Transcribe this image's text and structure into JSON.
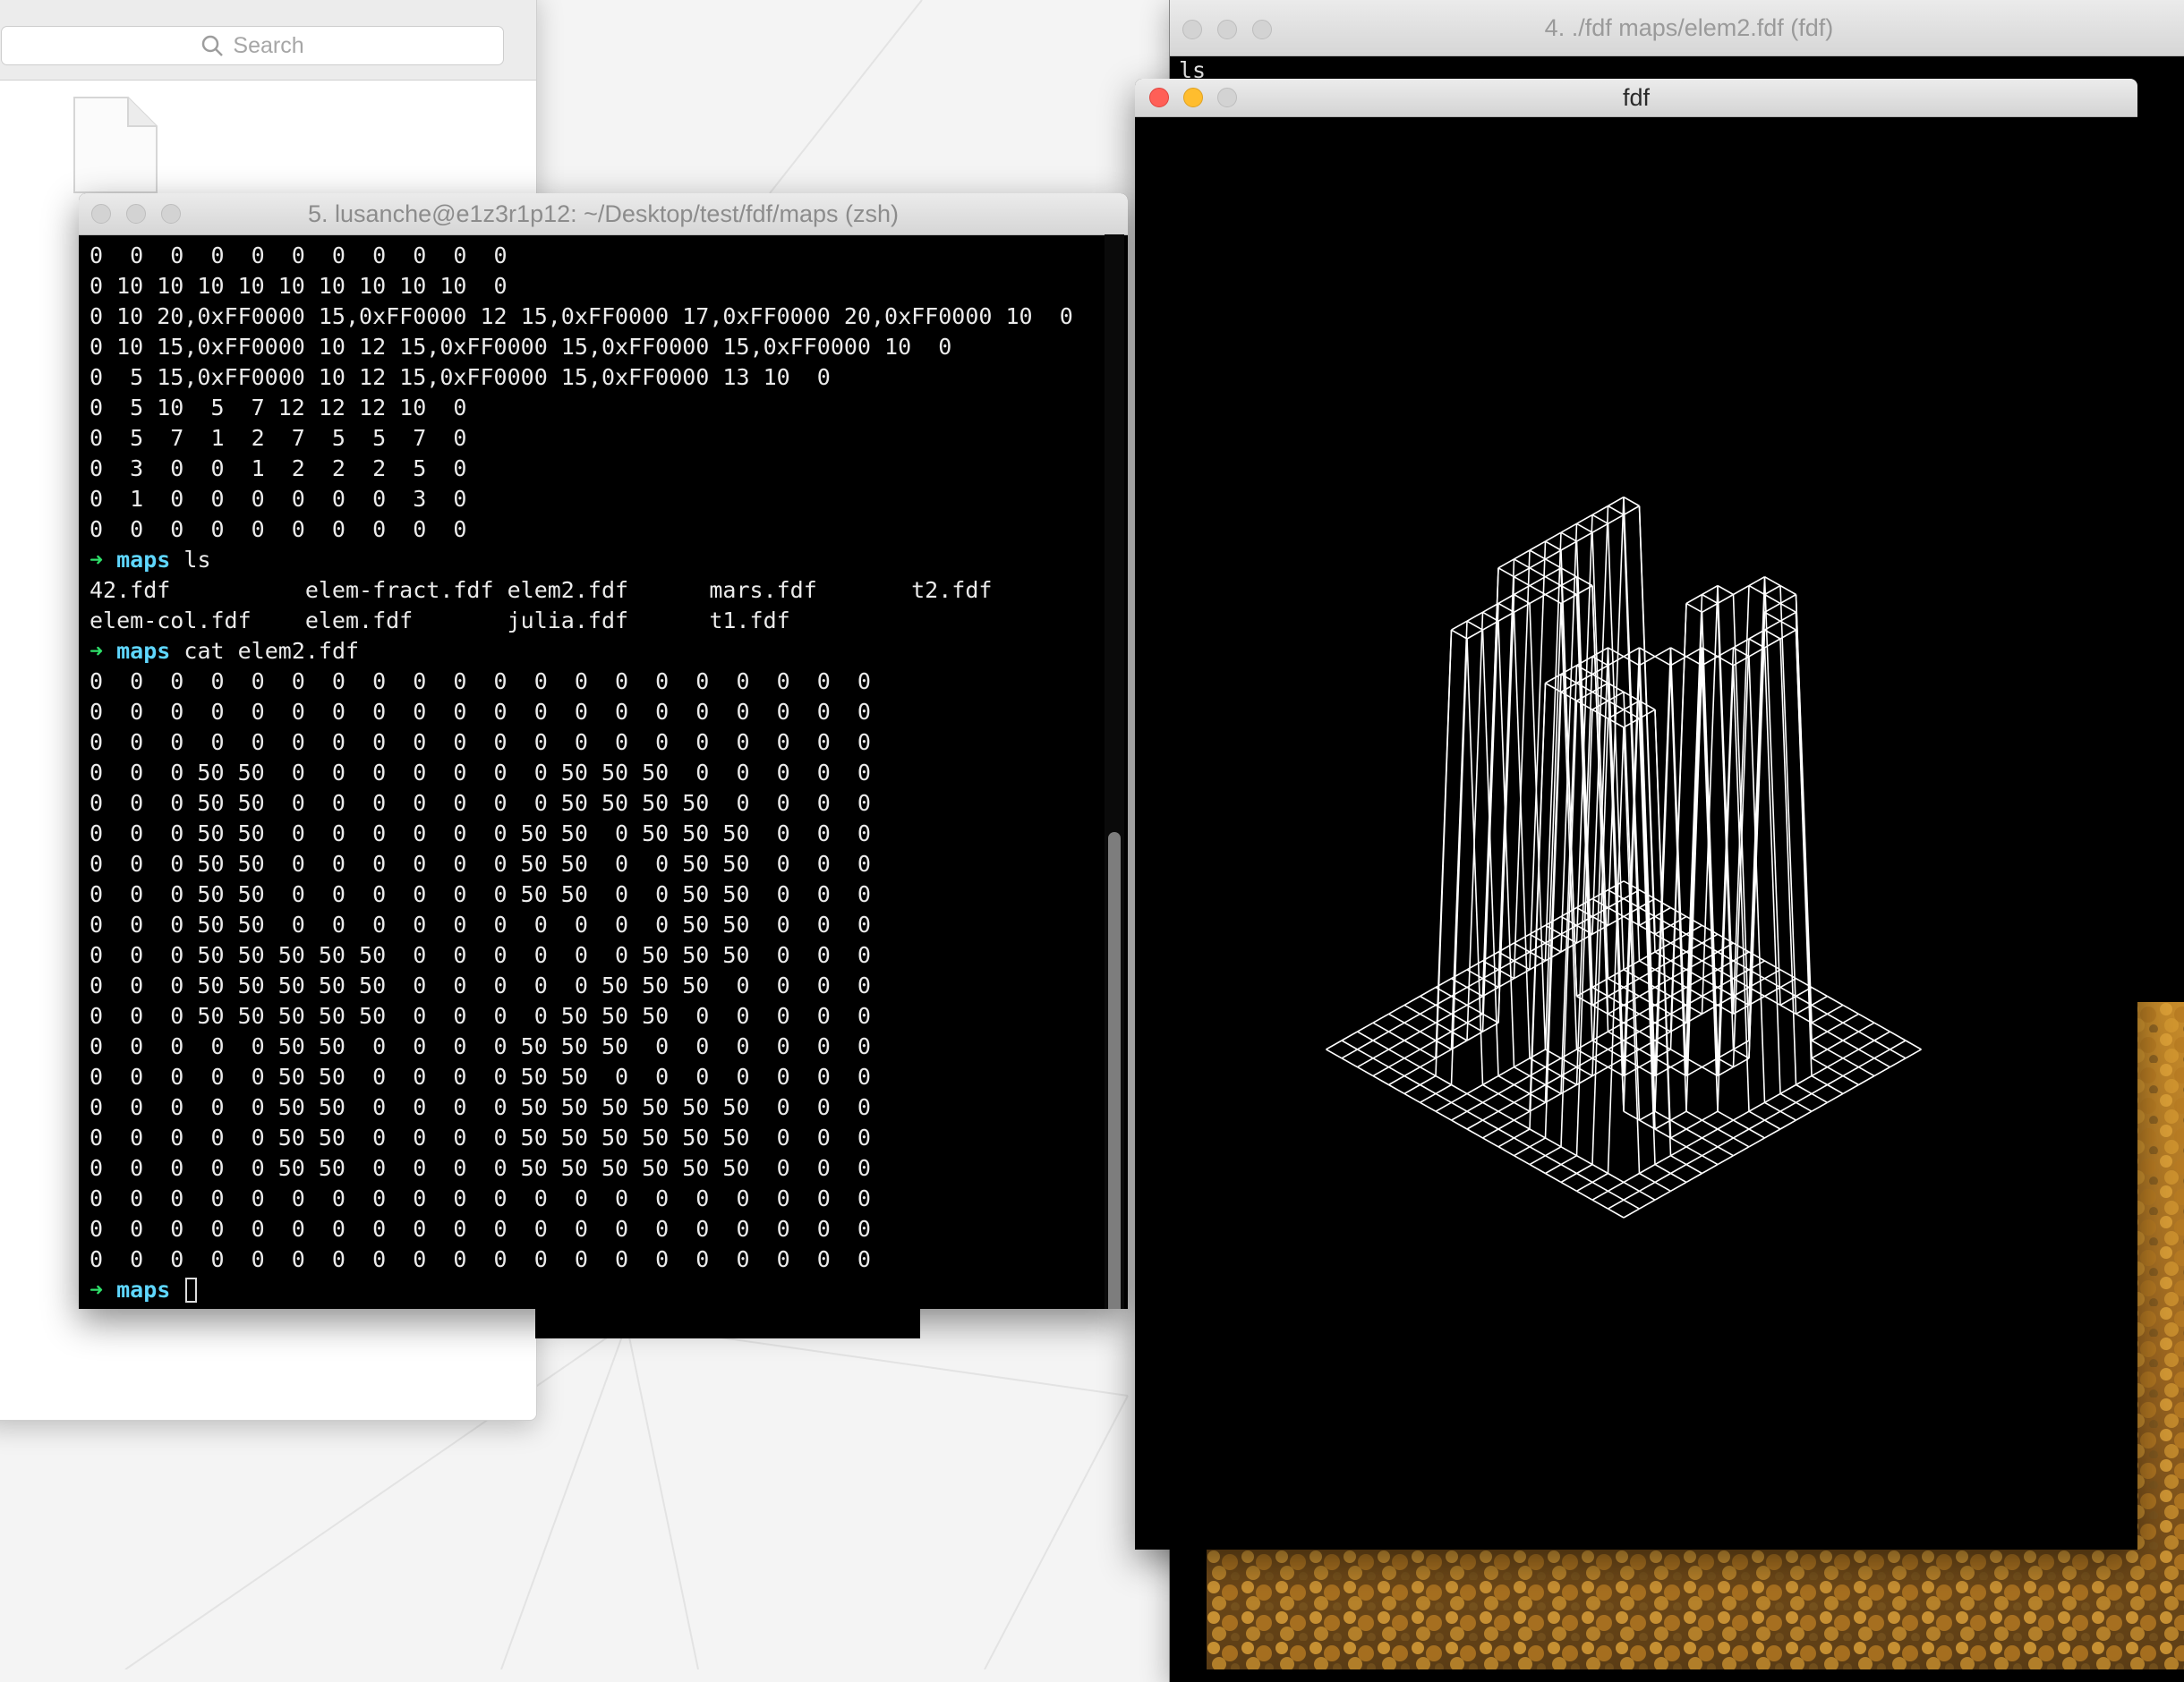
{
  "finder": {
    "search_placeholder": "Search",
    "icons": {
      "search": "magnifier-icon",
      "file": "document-icon"
    }
  },
  "term4": {
    "title": "4. ./fdf maps/elem2.fdf (fdf)",
    "visible_text": "ls"
  },
  "fdf_window": {
    "title": "fdf",
    "map_name": "elem2.fdf",
    "grid": [
      [
        0,
        0,
        0,
        0,
        0,
        0,
        0,
        0,
        0,
        0,
        0,
        0,
        0,
        0,
        0,
        0,
        0,
        0,
        0,
        0
      ],
      [
        0,
        0,
        0,
        0,
        0,
        0,
        0,
        0,
        0,
        0,
        0,
        0,
        0,
        0,
        0,
        0,
        0,
        0,
        0,
        0
      ],
      [
        0,
        0,
        0,
        0,
        0,
        0,
        0,
        0,
        0,
        0,
        0,
        0,
        0,
        0,
        0,
        0,
        0,
        0,
        0,
        0
      ],
      [
        0,
        0,
        0,
        50,
        50,
        0,
        0,
        0,
        0,
        0,
        0,
        0,
        50,
        50,
        50,
        0,
        0,
        0,
        0,
        0
      ],
      [
        0,
        0,
        0,
        50,
        50,
        0,
        0,
        0,
        0,
        0,
        0,
        0,
        50,
        50,
        50,
        50,
        0,
        0,
        0,
        0
      ],
      [
        0,
        0,
        0,
        50,
        50,
        0,
        0,
        0,
        0,
        0,
        0,
        50,
        50,
        0,
        50,
        50,
        50,
        0,
        0,
        0
      ],
      [
        0,
        0,
        0,
        50,
        50,
        0,
        0,
        0,
        0,
        0,
        0,
        50,
        50,
        0,
        0,
        50,
        50,
        0,
        0,
        0
      ],
      [
        0,
        0,
        0,
        50,
        50,
        0,
        0,
        0,
        0,
        0,
        0,
        50,
        50,
        0,
        0,
        50,
        50,
        0,
        0,
        0
      ],
      [
        0,
        0,
        0,
        50,
        50,
        0,
        0,
        0,
        0,
        0,
        0,
        0,
        0,
        0,
        0,
        50,
        50,
        0,
        0,
        0
      ],
      [
        0,
        0,
        0,
        50,
        50,
        50,
        50,
        50,
        0,
        0,
        0,
        0,
        0,
        0,
        50,
        50,
        50,
        0,
        0,
        0
      ],
      [
        0,
        0,
        0,
        50,
        50,
        50,
        50,
        50,
        0,
        0,
        0,
        0,
        0,
        50,
        50,
        50,
        0,
        0,
        0,
        0
      ],
      [
        0,
        0,
        0,
        50,
        50,
        50,
        50,
        50,
        0,
        0,
        0,
        0,
        50,
        50,
        50,
        0,
        0,
        0,
        0,
        0
      ],
      [
        0,
        0,
        0,
        0,
        0,
        50,
        50,
        0,
        0,
        0,
        0,
        50,
        50,
        50,
        0,
        0,
        0,
        0,
        0,
        0
      ],
      [
        0,
        0,
        0,
        0,
        0,
        50,
        50,
        0,
        0,
        0,
        0,
        50,
        50,
        0,
        0,
        0,
        0,
        0,
        0,
        0
      ],
      [
        0,
        0,
        0,
        0,
        0,
        50,
        50,
        0,
        0,
        0,
        0,
        50,
        50,
        50,
        50,
        50,
        50,
        0,
        0,
        0
      ],
      [
        0,
        0,
        0,
        0,
        0,
        50,
        50,
        0,
        0,
        0,
        0,
        50,
        50,
        50,
        50,
        50,
        50,
        0,
        0,
        0
      ],
      [
        0,
        0,
        0,
        0,
        0,
        50,
        50,
        0,
        0,
        0,
        0,
        50,
        50,
        50,
        50,
        50,
        50,
        0,
        0,
        0
      ],
      [
        0,
        0,
        0,
        0,
        0,
        0,
        0,
        0,
        0,
        0,
        0,
        0,
        0,
        0,
        0,
        0,
        0,
        0,
        0,
        0
      ],
      [
        0,
        0,
        0,
        0,
        0,
        0,
        0,
        0,
        0,
        0,
        0,
        0,
        0,
        0,
        0,
        0,
        0,
        0,
        0,
        0
      ],
      [
        0,
        0,
        0,
        0,
        0,
        0,
        0,
        0,
        0,
        0,
        0,
        0,
        0,
        0,
        0,
        0,
        0,
        0,
        0,
        0
      ]
    ],
    "line_color": "#ffffff",
    "background": "#000000"
  },
  "terminal": {
    "title": "5. lusanche@e1z3r1p12: ~/Desktop/test/fdf/maps (zsh)",
    "prompt_arrow": "➜",
    "prompt_dir": "maps",
    "colors": {
      "arrow": "#2fe06a",
      "dir": "#5fd7ff",
      "text": "#ebebeb"
    },
    "lines": [
      {
        "text": "0  0  0  0  0  0  0  0  0  0  0"
      },
      {
        "text": "0 10 10 10 10 10 10 10 10 10  0"
      },
      {
        "text": "0 10 20,0xFF0000 15,0xFF0000 12 15,0xFF0000 17,0xFF0000 20,0xFF0000 10  0"
      },
      {
        "text": "0 10 15,0xFF0000 10 12 15,0xFF0000 15,0xFF0000 15,0xFF0000 10  0"
      },
      {
        "text": "0  5 15,0xFF0000 10 12 15,0xFF0000 15,0xFF0000 13 10  0"
      },
      {
        "text": "0  5 10  5  7 12 12 12 10  0"
      },
      {
        "text": "0  5  7  1  2  7  5  5  7  0"
      },
      {
        "text": "0  3  0  0  1  2  2  2  5  0"
      },
      {
        "text": "0  1  0  0  0  0  0  0  3  0"
      },
      {
        "text": "0  0  0  0  0  0  0  0  0  0"
      },
      {
        "prompt": true,
        "text": "ls"
      },
      {
        "text": "42.fdf          elem-fract.fdf elem2.fdf      mars.fdf       t2.fdf"
      },
      {
        "text": "elem-col.fdf    elem.fdf       julia.fdf      t1.fdf"
      },
      {
        "prompt": true,
        "text": "cat elem2.fdf"
      },
      {
        "text": "0  0  0  0  0  0  0  0  0  0  0  0  0  0  0  0  0  0  0  0"
      },
      {
        "text": "0  0  0  0  0  0  0  0  0  0  0  0  0  0  0  0  0  0  0  0"
      },
      {
        "text": "0  0  0  0  0  0  0  0  0  0  0  0  0  0  0  0  0  0  0  0"
      },
      {
        "text": "0  0  0 50 50  0  0  0  0  0  0  0 50 50 50  0  0  0  0  0"
      },
      {
        "text": "0  0  0 50 50  0  0  0  0  0  0  0 50 50 50 50  0  0  0  0"
      },
      {
        "text": "0  0  0 50 50  0  0  0  0  0  0 50 50  0 50 50 50  0  0  0"
      },
      {
        "text": "0  0  0 50 50  0  0  0  0  0  0 50 50  0  0 50 50  0  0  0"
      },
      {
        "text": "0  0  0 50 50  0  0  0  0  0  0 50 50  0  0 50 50  0  0  0"
      },
      {
        "text": "0  0  0 50 50  0  0  0  0  0  0  0  0  0  0 50 50  0  0  0"
      },
      {
        "text": "0  0  0 50 50 50 50 50  0  0  0  0  0  0 50 50 50  0  0  0"
      },
      {
        "text": "0  0  0 50 50 50 50 50  0  0  0  0  0 50 50 50  0  0  0  0"
      },
      {
        "text": "0  0  0 50 50 50 50 50  0  0  0  0 50 50 50  0  0  0  0  0"
      },
      {
        "text": "0  0  0  0  0 50 50  0  0  0  0 50 50 50  0  0  0  0  0  0"
      },
      {
        "text": "0  0  0  0  0 50 50  0  0  0  0 50 50  0  0  0  0  0  0  0"
      },
      {
        "text": "0  0  0  0  0 50 50  0  0  0  0 50 50 50 50 50 50  0  0  0"
      },
      {
        "text": "0  0  0  0  0 50 50  0  0  0  0 50 50 50 50 50 50  0  0  0"
      },
      {
        "text": "0  0  0  0  0 50 50  0  0  0  0 50 50 50 50 50 50  0  0  0"
      },
      {
        "text": "0  0  0  0  0  0  0  0  0  0  0  0  0  0  0  0  0  0  0  0"
      },
      {
        "text": "0  0  0  0  0  0  0  0  0  0  0  0  0  0  0  0  0  0  0  0"
      },
      {
        "text": "0  0  0  0  0  0  0  0  0  0  0  0  0  0  0  0  0  0  0  0"
      },
      {
        "prompt": true,
        "text": "",
        "cursor": true
      }
    ]
  }
}
